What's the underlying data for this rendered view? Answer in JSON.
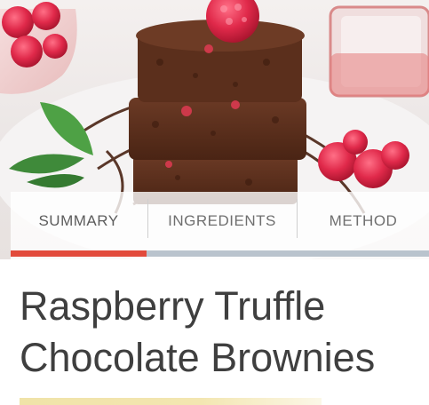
{
  "tabs": {
    "items": [
      {
        "label": "SUMMARY",
        "active": true
      },
      {
        "label": "INGREDIENTS",
        "active": false
      },
      {
        "label": "METHOD",
        "active": false
      }
    ],
    "active_color": "#e24a3b",
    "inactive_color": "#b9c3cd"
  },
  "recipe": {
    "title_line1": "Raspberry Truffle",
    "title_line2": "Chocolate Brownies"
  }
}
